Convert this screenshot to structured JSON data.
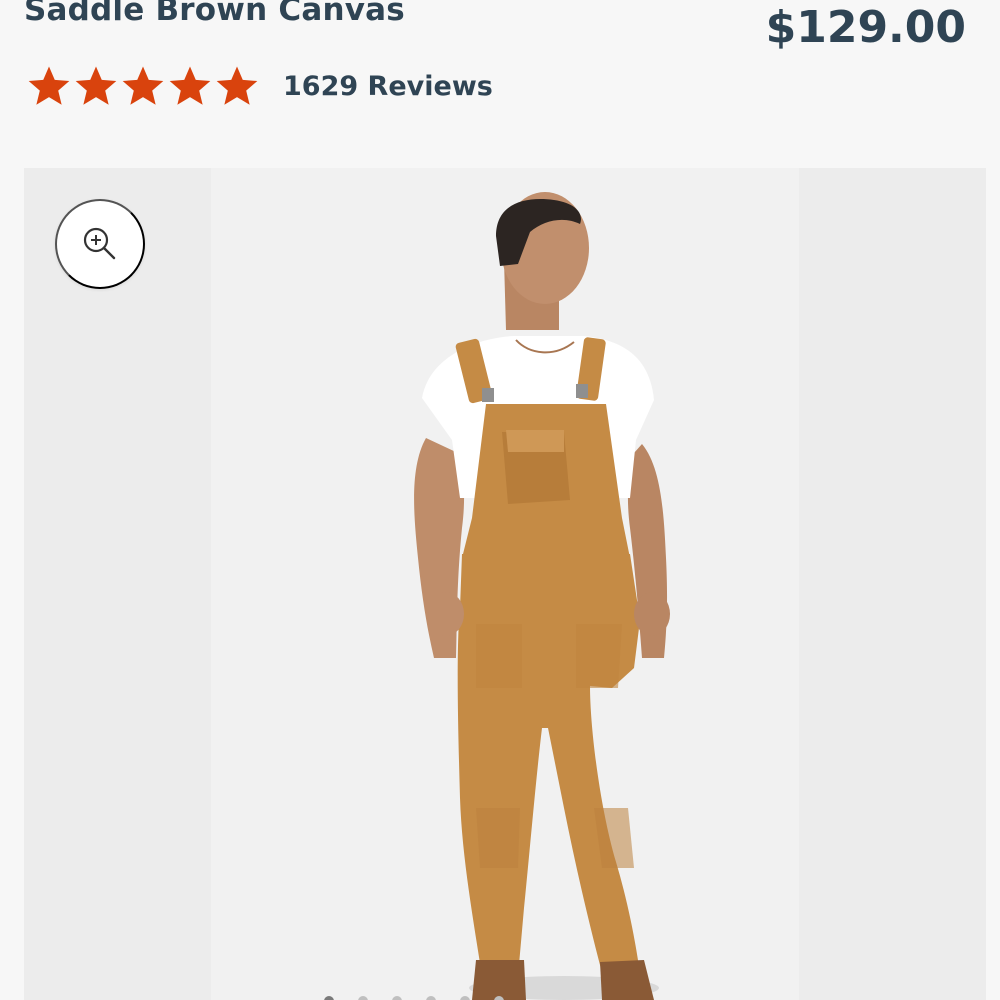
{
  "product": {
    "title": "Saddle Brown Canvas",
    "price": "$129.00",
    "rating": 5,
    "rating_max": 5,
    "review_count": "1629 Reviews"
  },
  "gallery": {
    "zoom_icon": "zoom-in-icon",
    "current_image": 1
  },
  "colors": {
    "text": "#2f4454",
    "star": "#d9430d",
    "overalls": "#c58b45",
    "background": "#f7f7f7"
  }
}
